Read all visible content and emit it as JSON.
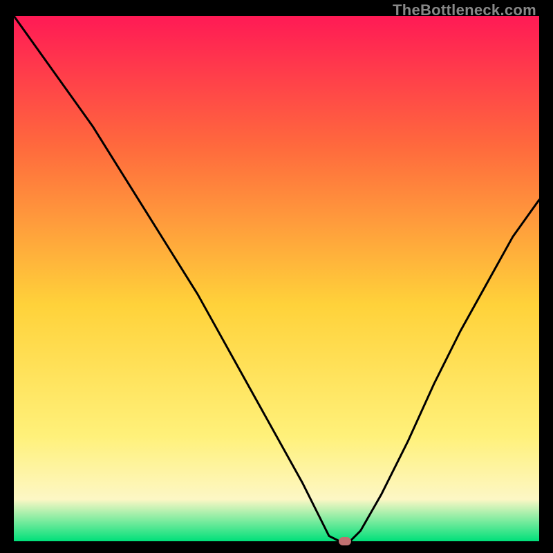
{
  "watermark": "TheBottleneck.com",
  "colors": {
    "frame": "#000000",
    "gradient_top": "#ff1a55",
    "gradient_mid1": "#ff6a3d",
    "gradient_mid2": "#ffd23a",
    "gradient_mid3": "#fff17a",
    "gradient_cream": "#fdf7c5",
    "gradient_bottom": "#00e07a",
    "curve": "#000000",
    "marker": "#c17071"
  },
  "chart_data": {
    "type": "line",
    "title": "",
    "xlabel": "",
    "ylabel": "",
    "xlim": [
      0,
      100
    ],
    "ylim": [
      0,
      100
    ],
    "legend": false,
    "grid": false,
    "annotations": [],
    "series": [
      {
        "name": "curve",
        "x": [
          0,
          5,
          10,
          15,
          20,
          25,
          30,
          35,
          40,
          45,
          50,
          55,
          58,
          60,
          62,
          64,
          66,
          70,
          75,
          80,
          85,
          90,
          95,
          100
        ],
        "values": [
          100,
          93,
          86,
          79,
          71,
          63,
          55,
          47,
          38,
          29,
          20,
          11,
          5,
          1,
          0,
          0,
          2,
          9,
          19,
          30,
          40,
          49,
          58,
          65
        ]
      }
    ],
    "marker": {
      "x": 63,
      "y": 0
    }
  }
}
